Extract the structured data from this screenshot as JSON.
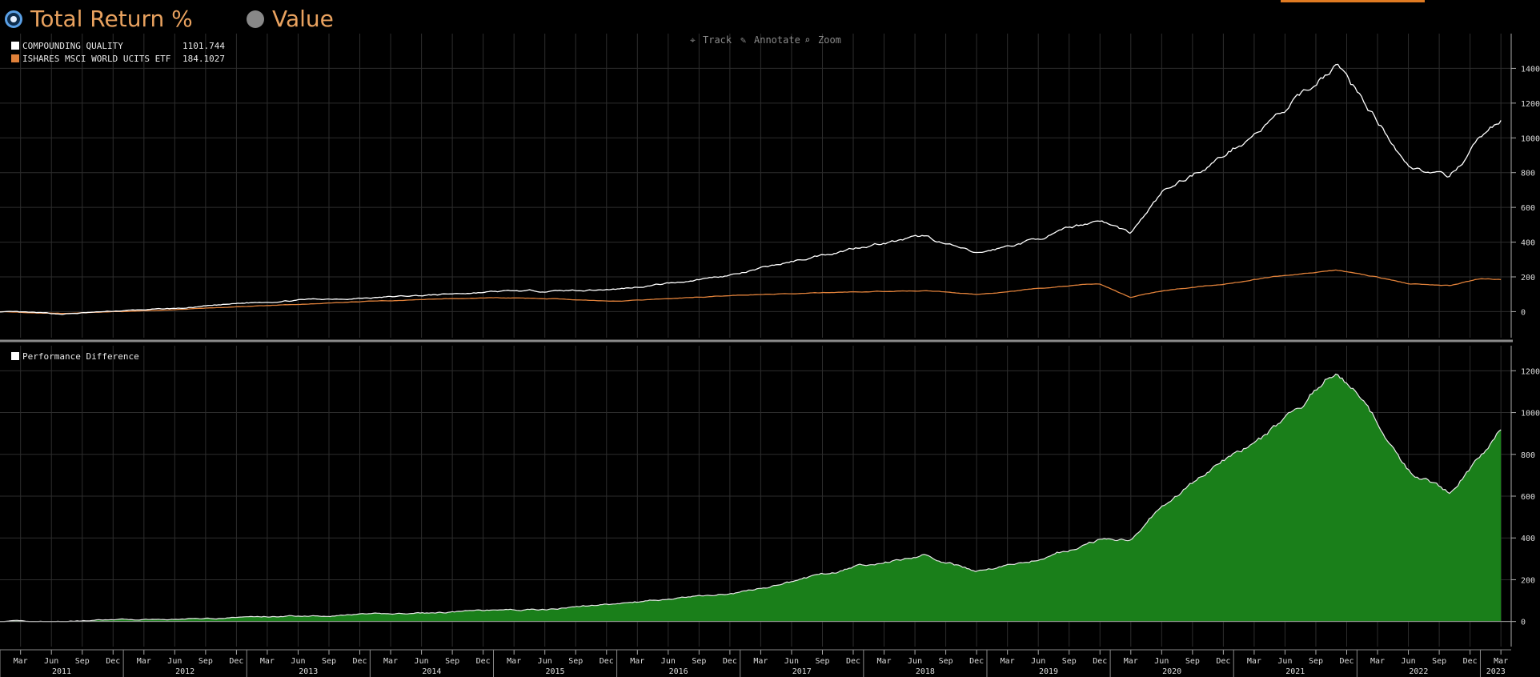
{
  "header": {
    "radio_total_return": "Total Return %",
    "radio_value": "Value"
  },
  "toolbar": {
    "track": "Track",
    "annotate": "Annotate",
    "zoom": "Zoom"
  },
  "colors": {
    "series_cq": "#ffffff",
    "series_msci": "#e0813a",
    "fill_diff": "#1a7f1a",
    "grid": "#2d2d2d",
    "accent": "#e9a25f"
  },
  "chart_data": [
    {
      "type": "line",
      "legend_placement": "top-left",
      "ylim": [
        -150,
        1600
      ],
      "yticks": [
        0,
        200,
        400,
        600,
        800,
        1000,
        1200,
        1400
      ],
      "x": [
        "2011-01",
        "2011-07",
        "2012-01",
        "2012-07",
        "2013-01",
        "2013-07",
        "2014-01",
        "2014-07",
        "2015-01",
        "2015-07",
        "2016-01",
        "2016-07",
        "2017-01",
        "2017-07",
        "2018-01",
        "2018-07",
        "2018-12",
        "2019-06",
        "2019-12",
        "2020-03",
        "2020-06",
        "2020-12",
        "2021-06",
        "2021-11",
        "2022-03",
        "2022-06",
        "2022-10",
        "2023-01",
        "2023-03"
      ],
      "series": [
        {
          "name": "COMPOUNDING QUALITY",
          "last_value": "1101.744",
          "values": [
            0,
            -15,
            5,
            20,
            50,
            70,
            80,
            95,
            115,
            120,
            130,
            170,
            220,
            300,
            380,
            430,
            330,
            420,
            530,
            450,
            680,
            900,
            1150,
            1430,
            1100,
            850,
            760,
            1000,
            1101
          ]
        },
        {
          "name": "ISHARES MSCI WORLD UCITS ETF",
          "last_value": "184.1027",
          "values": [
            0,
            -10,
            0,
            15,
            30,
            45,
            60,
            70,
            80,
            75,
            60,
            80,
            95,
            105,
            115,
            120,
            100,
            135,
            160,
            80,
            120,
            160,
            210,
            235,
            200,
            160,
            150,
            190,
            184
          ]
        }
      ]
    },
    {
      "type": "area",
      "legend_placement": "top-left",
      "ylim": [
        -120,
        1320
      ],
      "yticks": [
        0,
        200,
        400,
        600,
        800,
        1000,
        1200
      ],
      "x": [
        "2011-01",
        "2011-07",
        "2012-01",
        "2012-07",
        "2013-01",
        "2013-07",
        "2014-01",
        "2014-07",
        "2015-01",
        "2015-07",
        "2016-01",
        "2016-07",
        "2017-01",
        "2017-07",
        "2018-01",
        "2018-07",
        "2018-12",
        "2019-06",
        "2019-12",
        "2020-03",
        "2020-06",
        "2020-12",
        "2021-06",
        "2021-11",
        "2022-03",
        "2022-06",
        "2022-10",
        "2023-01",
        "2023-03"
      ],
      "series": [
        {
          "name": "Performance Difference",
          "values": [
            0,
            0,
            8,
            12,
            22,
            28,
            35,
            40,
            55,
            60,
            85,
            110,
            140,
            200,
            270,
            320,
            240,
            300,
            390,
            400,
            560,
            760,
            950,
            1210,
            950,
            720,
            620,
            800,
            918
          ]
        }
      ]
    }
  ],
  "xaxis": {
    "months": [
      "Mar",
      "Jun",
      "Sep",
      "Dec",
      "Mar",
      "Jun",
      "Sep",
      "Dec",
      "Mar",
      "Jun",
      "Sep",
      "Dec",
      "Mar",
      "Jun",
      "Sep",
      "Dec",
      "Mar",
      "Jun",
      "Sep",
      "Dec",
      "Mar",
      "Jun",
      "Sep",
      "Dec",
      "Mar",
      "Jun",
      "Sep",
      "Dec",
      "Mar",
      "Jun",
      "Sep",
      "Dec",
      "Mar",
      "Jun",
      "Sep",
      "Dec",
      "Mar",
      "Jun",
      "Sep",
      "Dec",
      "Mar",
      "Jun",
      "Sep",
      "Dec",
      "Mar",
      "Jun",
      "Sep",
      "Dec",
      "Mar"
    ],
    "years": [
      "2011",
      "2012",
      "2013",
      "2014",
      "2015",
      "2016",
      "2017",
      "2018",
      "2019",
      "2020",
      "2021",
      "2022",
      "2023"
    ]
  }
}
